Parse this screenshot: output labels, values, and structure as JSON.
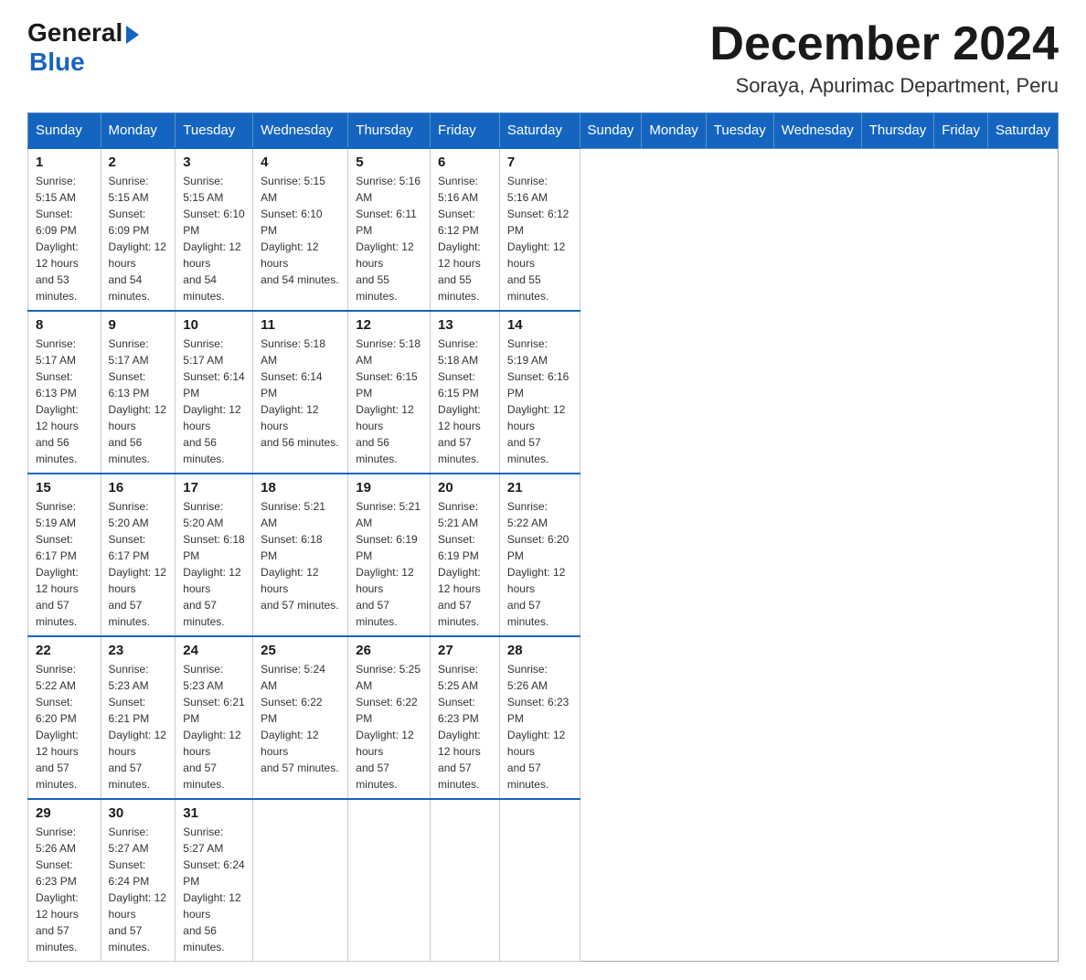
{
  "header": {
    "logo_general": "General",
    "logo_blue": "Blue",
    "month_title": "December 2024",
    "location": "Soraya, Apurimac Department, Peru"
  },
  "weekdays": [
    "Sunday",
    "Monday",
    "Tuesday",
    "Wednesday",
    "Thursday",
    "Friday",
    "Saturday"
  ],
  "weeks": [
    [
      {
        "day": "1",
        "sunrise": "5:15 AM",
        "sunset": "6:09 PM",
        "daylight": "12 hours and 53 minutes."
      },
      {
        "day": "2",
        "sunrise": "5:15 AM",
        "sunset": "6:09 PM",
        "daylight": "12 hours and 54 minutes."
      },
      {
        "day": "3",
        "sunrise": "5:15 AM",
        "sunset": "6:10 PM",
        "daylight": "12 hours and 54 minutes."
      },
      {
        "day": "4",
        "sunrise": "5:15 AM",
        "sunset": "6:10 PM",
        "daylight": "12 hours and 54 minutes."
      },
      {
        "day": "5",
        "sunrise": "5:16 AM",
        "sunset": "6:11 PM",
        "daylight": "12 hours and 55 minutes."
      },
      {
        "day": "6",
        "sunrise": "5:16 AM",
        "sunset": "6:12 PM",
        "daylight": "12 hours and 55 minutes."
      },
      {
        "day": "7",
        "sunrise": "5:16 AM",
        "sunset": "6:12 PM",
        "daylight": "12 hours and 55 minutes."
      }
    ],
    [
      {
        "day": "8",
        "sunrise": "5:17 AM",
        "sunset": "6:13 PM",
        "daylight": "12 hours and 56 minutes."
      },
      {
        "day": "9",
        "sunrise": "5:17 AM",
        "sunset": "6:13 PM",
        "daylight": "12 hours and 56 minutes."
      },
      {
        "day": "10",
        "sunrise": "5:17 AM",
        "sunset": "6:14 PM",
        "daylight": "12 hours and 56 minutes."
      },
      {
        "day": "11",
        "sunrise": "5:18 AM",
        "sunset": "6:14 PM",
        "daylight": "12 hours and 56 minutes."
      },
      {
        "day": "12",
        "sunrise": "5:18 AM",
        "sunset": "6:15 PM",
        "daylight": "12 hours and 56 minutes."
      },
      {
        "day": "13",
        "sunrise": "5:18 AM",
        "sunset": "6:15 PM",
        "daylight": "12 hours and 57 minutes."
      },
      {
        "day": "14",
        "sunrise": "5:19 AM",
        "sunset": "6:16 PM",
        "daylight": "12 hours and 57 minutes."
      }
    ],
    [
      {
        "day": "15",
        "sunrise": "5:19 AM",
        "sunset": "6:17 PM",
        "daylight": "12 hours and 57 minutes."
      },
      {
        "day": "16",
        "sunrise": "5:20 AM",
        "sunset": "6:17 PM",
        "daylight": "12 hours and 57 minutes."
      },
      {
        "day": "17",
        "sunrise": "5:20 AM",
        "sunset": "6:18 PM",
        "daylight": "12 hours and 57 minutes."
      },
      {
        "day": "18",
        "sunrise": "5:21 AM",
        "sunset": "6:18 PM",
        "daylight": "12 hours and 57 minutes."
      },
      {
        "day": "19",
        "sunrise": "5:21 AM",
        "sunset": "6:19 PM",
        "daylight": "12 hours and 57 minutes."
      },
      {
        "day": "20",
        "sunrise": "5:21 AM",
        "sunset": "6:19 PM",
        "daylight": "12 hours and 57 minutes."
      },
      {
        "day": "21",
        "sunrise": "5:22 AM",
        "sunset": "6:20 PM",
        "daylight": "12 hours and 57 minutes."
      }
    ],
    [
      {
        "day": "22",
        "sunrise": "5:22 AM",
        "sunset": "6:20 PM",
        "daylight": "12 hours and 57 minutes."
      },
      {
        "day": "23",
        "sunrise": "5:23 AM",
        "sunset": "6:21 PM",
        "daylight": "12 hours and 57 minutes."
      },
      {
        "day": "24",
        "sunrise": "5:23 AM",
        "sunset": "6:21 PM",
        "daylight": "12 hours and 57 minutes."
      },
      {
        "day": "25",
        "sunrise": "5:24 AM",
        "sunset": "6:22 PM",
        "daylight": "12 hours and 57 minutes."
      },
      {
        "day": "26",
        "sunrise": "5:25 AM",
        "sunset": "6:22 PM",
        "daylight": "12 hours and 57 minutes."
      },
      {
        "day": "27",
        "sunrise": "5:25 AM",
        "sunset": "6:23 PM",
        "daylight": "12 hours and 57 minutes."
      },
      {
        "day": "28",
        "sunrise": "5:26 AM",
        "sunset": "6:23 PM",
        "daylight": "12 hours and 57 minutes."
      }
    ],
    [
      {
        "day": "29",
        "sunrise": "5:26 AM",
        "sunset": "6:23 PM",
        "daylight": "12 hours and 57 minutes."
      },
      {
        "day": "30",
        "sunrise": "5:27 AM",
        "sunset": "6:24 PM",
        "daylight": "12 hours and 57 minutes."
      },
      {
        "day": "31",
        "sunrise": "5:27 AM",
        "sunset": "6:24 PM",
        "daylight": "12 hours and 56 minutes."
      },
      null,
      null,
      null,
      null
    ]
  ]
}
